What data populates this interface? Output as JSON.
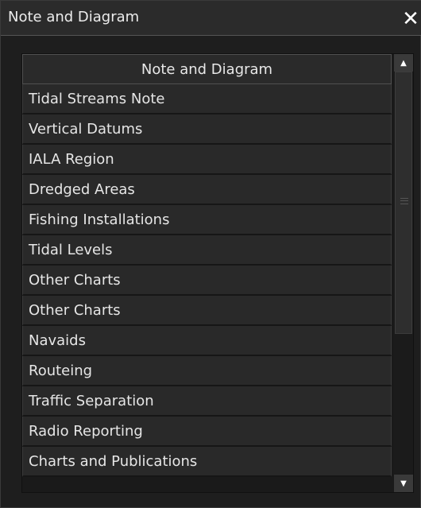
{
  "window": {
    "title": "Note and Diagram",
    "close_icon": "close-icon"
  },
  "list": {
    "header": "Note and Diagram",
    "items": [
      "Tidal Streams Note",
      "Vertical Datums",
      "IALA Region",
      "Dredged Areas",
      "Fishing Installations",
      "Tidal Levels",
      "Other Charts",
      "Other Charts",
      "Navaids",
      "Routeing",
      "Traffic Separation",
      "Radio Reporting",
      "Charts and Publications"
    ]
  },
  "scrollbar": {
    "up_icon": "scroll-up-arrow-icon",
    "down_icon": "scroll-down-arrow-icon"
  }
}
